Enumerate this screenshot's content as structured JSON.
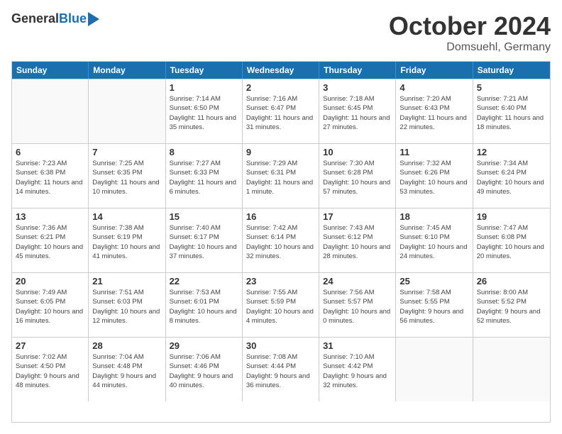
{
  "header": {
    "logo_general": "General",
    "logo_blue": "Blue",
    "month_title": "October 2024",
    "location": "Domsuehl, Germany"
  },
  "days_of_week": [
    "Sunday",
    "Monday",
    "Tuesday",
    "Wednesday",
    "Thursday",
    "Friday",
    "Saturday"
  ],
  "weeks": [
    [
      {
        "day": "",
        "empty": true
      },
      {
        "day": "",
        "empty": true
      },
      {
        "day": "1",
        "sunrise": "7:14 AM",
        "sunset": "6:50 PM",
        "daylight": "11 hours and 35 minutes."
      },
      {
        "day": "2",
        "sunrise": "7:16 AM",
        "sunset": "6:47 PM",
        "daylight": "11 hours and 31 minutes."
      },
      {
        "day": "3",
        "sunrise": "7:18 AM",
        "sunset": "6:45 PM",
        "daylight": "11 hours and 27 minutes."
      },
      {
        "day": "4",
        "sunrise": "7:20 AM",
        "sunset": "6:43 PM",
        "daylight": "11 hours and 22 minutes."
      },
      {
        "day": "5",
        "sunrise": "7:21 AM",
        "sunset": "6:40 PM",
        "daylight": "11 hours and 18 minutes."
      }
    ],
    [
      {
        "day": "6",
        "sunrise": "7:23 AM",
        "sunset": "6:38 PM",
        "daylight": "11 hours and 14 minutes."
      },
      {
        "day": "7",
        "sunrise": "7:25 AM",
        "sunset": "6:35 PM",
        "daylight": "11 hours and 10 minutes."
      },
      {
        "day": "8",
        "sunrise": "7:27 AM",
        "sunset": "6:33 PM",
        "daylight": "11 hours and 6 minutes."
      },
      {
        "day": "9",
        "sunrise": "7:29 AM",
        "sunset": "6:31 PM",
        "daylight": "11 hours and 1 minute."
      },
      {
        "day": "10",
        "sunrise": "7:30 AM",
        "sunset": "6:28 PM",
        "daylight": "10 hours and 57 minutes."
      },
      {
        "day": "11",
        "sunrise": "7:32 AM",
        "sunset": "6:26 PM",
        "daylight": "10 hours and 53 minutes."
      },
      {
        "day": "12",
        "sunrise": "7:34 AM",
        "sunset": "6:24 PM",
        "daylight": "10 hours and 49 minutes."
      }
    ],
    [
      {
        "day": "13",
        "sunrise": "7:36 AM",
        "sunset": "6:21 PM",
        "daylight": "10 hours and 45 minutes."
      },
      {
        "day": "14",
        "sunrise": "7:38 AM",
        "sunset": "6:19 PM",
        "daylight": "10 hours and 41 minutes."
      },
      {
        "day": "15",
        "sunrise": "7:40 AM",
        "sunset": "6:17 PM",
        "daylight": "10 hours and 37 minutes."
      },
      {
        "day": "16",
        "sunrise": "7:42 AM",
        "sunset": "6:14 PM",
        "daylight": "10 hours and 32 minutes."
      },
      {
        "day": "17",
        "sunrise": "7:43 AM",
        "sunset": "6:12 PM",
        "daylight": "10 hours and 28 minutes."
      },
      {
        "day": "18",
        "sunrise": "7:45 AM",
        "sunset": "6:10 PM",
        "daylight": "10 hours and 24 minutes."
      },
      {
        "day": "19",
        "sunrise": "7:47 AM",
        "sunset": "6:08 PM",
        "daylight": "10 hours and 20 minutes."
      }
    ],
    [
      {
        "day": "20",
        "sunrise": "7:49 AM",
        "sunset": "6:05 PM",
        "daylight": "10 hours and 16 minutes."
      },
      {
        "day": "21",
        "sunrise": "7:51 AM",
        "sunset": "6:03 PM",
        "daylight": "10 hours and 12 minutes."
      },
      {
        "day": "22",
        "sunrise": "7:53 AM",
        "sunset": "6:01 PM",
        "daylight": "10 hours and 8 minutes."
      },
      {
        "day": "23",
        "sunrise": "7:55 AM",
        "sunset": "5:59 PM",
        "daylight": "10 hours and 4 minutes."
      },
      {
        "day": "24",
        "sunrise": "7:56 AM",
        "sunset": "5:57 PM",
        "daylight": "10 hours and 0 minutes."
      },
      {
        "day": "25",
        "sunrise": "7:58 AM",
        "sunset": "5:55 PM",
        "daylight": "9 hours and 56 minutes."
      },
      {
        "day": "26",
        "sunrise": "8:00 AM",
        "sunset": "5:52 PM",
        "daylight": "9 hours and 52 minutes."
      }
    ],
    [
      {
        "day": "27",
        "sunrise": "7:02 AM",
        "sunset": "4:50 PM",
        "daylight": "9 hours and 48 minutes."
      },
      {
        "day": "28",
        "sunrise": "7:04 AM",
        "sunset": "4:48 PM",
        "daylight": "9 hours and 44 minutes."
      },
      {
        "day": "29",
        "sunrise": "7:06 AM",
        "sunset": "4:46 PM",
        "daylight": "9 hours and 40 minutes."
      },
      {
        "day": "30",
        "sunrise": "7:08 AM",
        "sunset": "4:44 PM",
        "daylight": "9 hours and 36 minutes."
      },
      {
        "day": "31",
        "sunrise": "7:10 AM",
        "sunset": "4:42 PM",
        "daylight": "9 hours and 32 minutes."
      },
      {
        "day": "",
        "empty": true
      },
      {
        "day": "",
        "empty": true
      }
    ]
  ]
}
